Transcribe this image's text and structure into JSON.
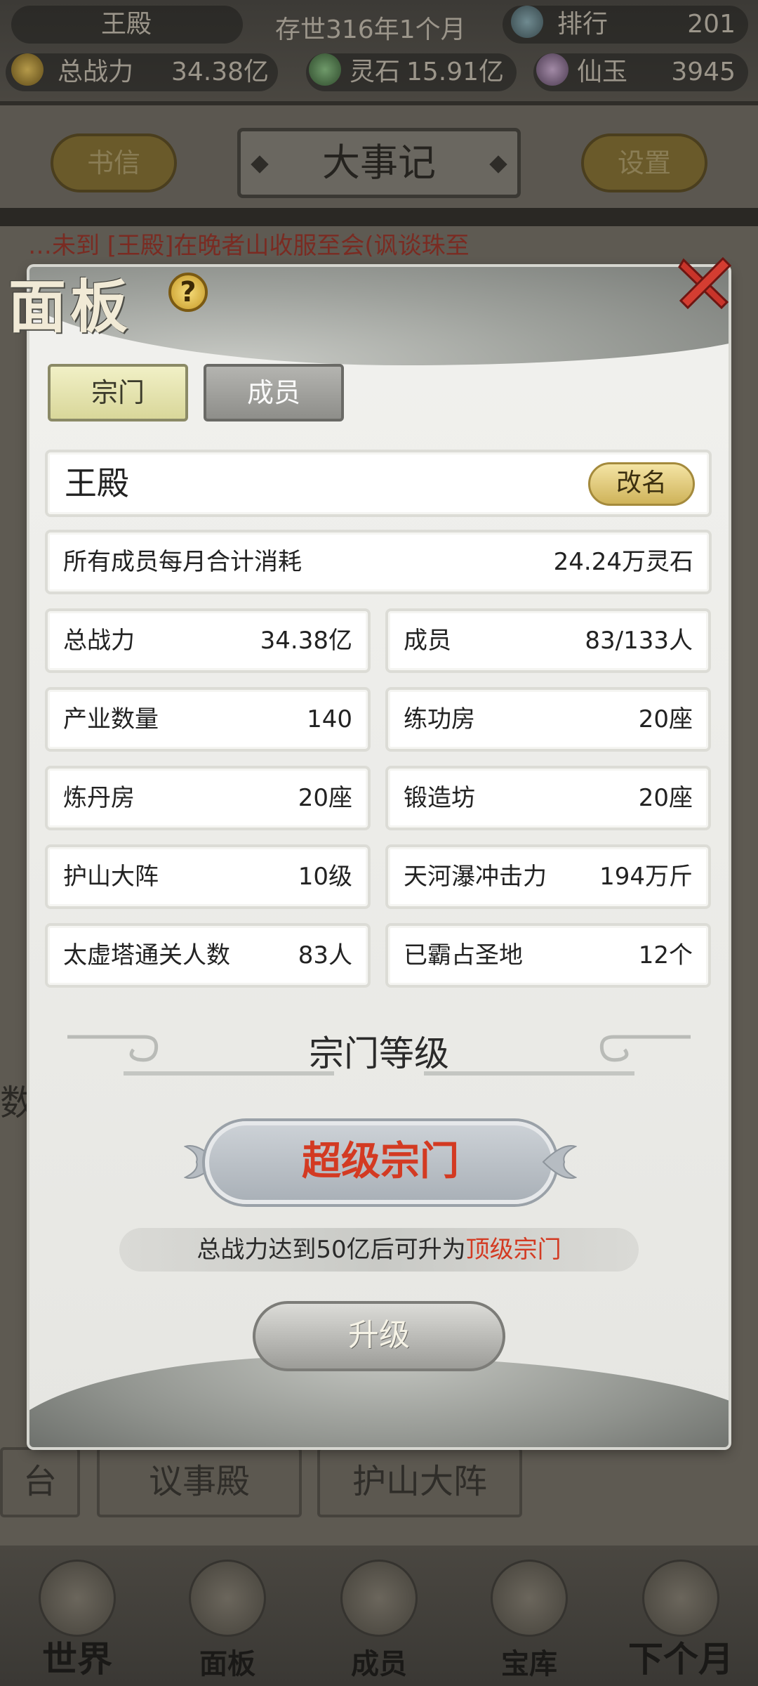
{
  "topbar": {
    "sect_name": "王殿",
    "age": "存世316年1个月",
    "rank_label": "排行",
    "rank_value": "201",
    "power_label": "总战力",
    "power_value": "34.38亿",
    "stone_label": "灵石",
    "stone_value": "15.91亿",
    "jade_label": "仙玉",
    "jade_value": "3945"
  },
  "header": {
    "left_button": "书信",
    "title": "大事记",
    "right_button": "设置"
  },
  "background": {
    "news_text": "…未到 [王殿]在晚者山收服至会(讽谈珠至",
    "left_partial": "台",
    "left_side_char": "数",
    "buildings": [
      "议事殿",
      "护山大阵"
    ]
  },
  "nav": {
    "items": [
      {
        "label": "世界",
        "icon": "world-icon"
      },
      {
        "label": "面板",
        "icon": "panel-icon"
      },
      {
        "label": "成员",
        "icon": "member-icon"
      },
      {
        "label": "宝库",
        "icon": "treasury-icon"
      },
      {
        "label": "下个月",
        "icon": "next-month-icon"
      }
    ]
  },
  "panel": {
    "title": "面板",
    "help_symbol": "?",
    "tabs": [
      {
        "label": "宗门",
        "active": true
      },
      {
        "label": "成员",
        "active": false
      }
    ],
    "sect_name": "王殿",
    "rename_label": "改名",
    "consumption": {
      "label": "所有成员每月合计消耗",
      "value": "24.24万灵石"
    },
    "stats": [
      {
        "label": "总战力",
        "value": "34.38亿"
      },
      {
        "label": "成员",
        "value": "83/133人"
      },
      {
        "label": "产业数量",
        "value": "140"
      },
      {
        "label": "练功房",
        "value": "20座"
      },
      {
        "label": "炼丹房",
        "value": "20座"
      },
      {
        "label": "锻造坊",
        "value": "20座"
      },
      {
        "label": "护山大阵",
        "value": "10级"
      },
      {
        "label": "天河瀑冲击力",
        "value": "194万斤"
      },
      {
        "label": "太虚塔通关人数",
        "value": "83人"
      },
      {
        "label": "已霸占圣地",
        "value": "12个"
      }
    ],
    "level_title": "宗门等级",
    "level_value": "超级宗门",
    "hint_prefix": "总战力达到50亿后可升为",
    "hint_target": "顶级宗门",
    "upgrade_label": "升级"
  },
  "colors": {
    "accent_red": "#d33a22",
    "tab_active": "#e4e3ad",
    "tab_inactive": "#9e9e9a",
    "gold": "#cfb35a"
  }
}
